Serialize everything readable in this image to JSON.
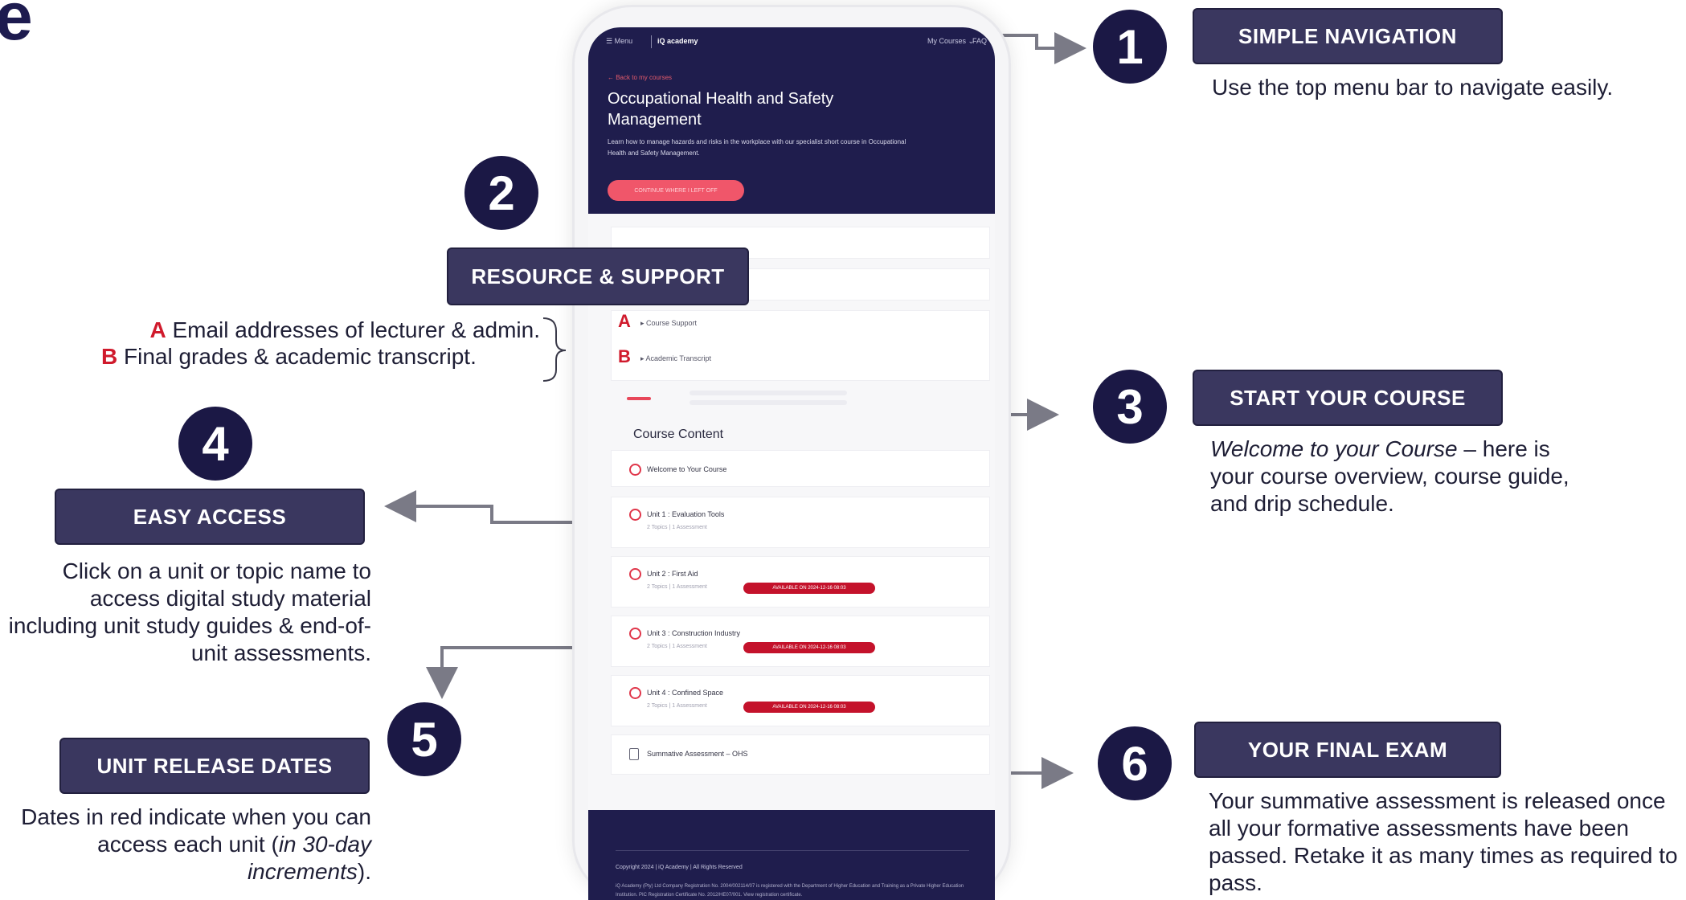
{
  "corner_letter": "e",
  "phone": {
    "topbar": {
      "menu": "☰ Menu",
      "brand": "iQ academy",
      "my_courses": "My Courses ⌄",
      "faq": "FAQ"
    },
    "back_link": "← Back to my courses",
    "course_title": "Occupational Health and Safety Management",
    "course_description": "Learn how to manage hazards and risks in the workplace with our specialist short course in Occupational Health and Safety Management.",
    "continue_button": "CONTINUE WHERE I LEFT OFF",
    "support_rows": [
      {
        "marker": "A",
        "label": "▸ Course Support"
      },
      {
        "marker": "B",
        "label": "▸ Academic Transcript"
      }
    ],
    "content_heading": "Course Content",
    "welcome_item": "Welcome to Your Course",
    "units": [
      {
        "title": "Unit 1 : Evaluation Tools",
        "meta": "2 Topics  |  1 Assessment",
        "badge": ""
      },
      {
        "title": "Unit 2 : First Aid",
        "meta": "2 Topics  |  1 Assessment",
        "badge": "AVAILABLE ON 2024-12-16 08:03"
      },
      {
        "title": "Unit 3 : Construction Industry",
        "meta": "2 Topics  |  1 Assessment",
        "badge": "AVAILABLE ON 2024-12-16 08:03"
      },
      {
        "title": "Unit 4 : Confined Space",
        "meta": "2 Topics  |  1 Assessment",
        "badge": "AVAILABLE ON 2024-12-16 08:03"
      }
    ],
    "summative_item": "Summative Assessment – OHS",
    "footer": {
      "copyright": "Copyright 2024 | iQ Academy | All Rights Reserved",
      "registration": "iQ Academy (Pty) Ltd Company Registration No. 2004/002114/07 is registered with the Department of Higher Education and Training as a Private Higher Education Institution. PIC Registration Certificate No. 2012/HE07/001. View registration certificate."
    }
  },
  "callouts": {
    "c1": {
      "number": "1",
      "title": "SIMPLE NAVIGATION",
      "text": "Use the top menu bar to navigate easily."
    },
    "c2": {
      "number": "2",
      "title": "RESOURCE & SUPPORT",
      "items": [
        {
          "marker": "A",
          "text": "Email addresses of lecturer & admin."
        },
        {
          "marker": "B",
          "text": "Final grades & academic transcript."
        }
      ]
    },
    "c3": {
      "number": "3",
      "title": "START YOUR COURSE",
      "text_italic": "Welcome to your Course",
      "text_rest": " – here is your course overview, course guide, and drip schedule."
    },
    "c4": {
      "number": "4",
      "title": "EASY ACCESS",
      "text": "Click on a unit or topic name to access digital study material including unit study guides & end-of-unit assessments."
    },
    "c5": {
      "number": "5",
      "title": "UNIT RELEASE DATES",
      "text_start": "Dates in red indicate when you can access each unit (",
      "text_italic": "in 30-day increments",
      "text_end": ")."
    },
    "c6": {
      "number": "6",
      "title": "YOUR FINAL EXAM",
      "text": "Your summative assessment is released once all your formative assessments have been passed. Retake it as many times as required to pass."
    }
  },
  "colors": {
    "navy": "#1b1845",
    "label_bg": "#3a375f",
    "accent_red": "#d01a2c",
    "badge_red": "#c4122b",
    "button_pink": "#f0566a"
  }
}
